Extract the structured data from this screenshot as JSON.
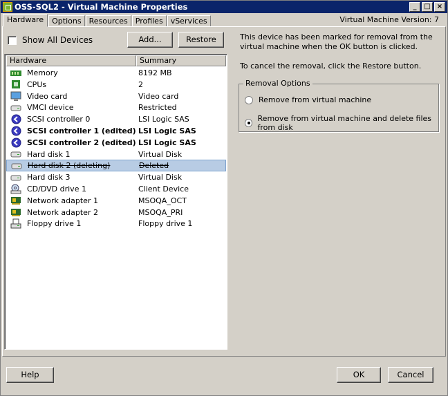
{
  "window": {
    "title": "OSS-SQL2 - Virtual Machine Properties",
    "version": "Virtual Machine Version: 7"
  },
  "tabs": [
    "Hardware",
    "Options",
    "Resources",
    "Profiles",
    "vServices"
  ],
  "show_all_devices": {
    "label": "Show All Devices",
    "checked": false
  },
  "buttons": {
    "add": "Add...",
    "restore": "Restore",
    "help": "Help",
    "ok": "OK",
    "cancel": "Cancel"
  },
  "table": {
    "headers": [
      "Hardware",
      "Summary"
    ],
    "rows": [
      {
        "name": "Memory",
        "summary": "8192 MB",
        "icon": "memory-icon"
      },
      {
        "name": "CPUs",
        "summary": "2",
        "icon": "cpu-icon"
      },
      {
        "name": "Video card",
        "summary": "Video card",
        "icon": "monitor-icon"
      },
      {
        "name": "VMCI device",
        "summary": "Restricted",
        "icon": "device-icon"
      },
      {
        "name": "SCSI controller 0",
        "summary": "LSI Logic SAS",
        "icon": "scsi-icon"
      },
      {
        "name": "SCSI controller 1 (edited)",
        "summary": "LSI Logic SAS",
        "icon": "scsi-icon",
        "edited": true
      },
      {
        "name": "SCSI controller 2 (edited)",
        "summary": "LSI Logic SAS",
        "icon": "scsi-icon",
        "edited": true
      },
      {
        "name": "Hard disk 1",
        "summary": "Virtual Disk",
        "icon": "hard-disk-icon"
      },
      {
        "name": "Hard disk 2 (deleting)",
        "summary": "Deleted",
        "icon": "hard-disk-icon",
        "deleting": true,
        "selected": true
      },
      {
        "name": "Hard disk 3",
        "summary": "Virtual Disk",
        "icon": "hard-disk-icon"
      },
      {
        "name": "CD/DVD drive 1",
        "summary": "Client Device",
        "icon": "cd-dvd-icon"
      },
      {
        "name": "Network adapter 1",
        "summary": "MSOQA_OCT",
        "icon": "network-adapter-icon"
      },
      {
        "name": "Network adapter 2",
        "summary": "MSOQA_PRI",
        "icon": "network-adapter-icon"
      },
      {
        "name": "Floppy drive 1",
        "summary": "Floppy drive 1",
        "icon": "floppy-icon"
      }
    ]
  },
  "details": {
    "line1": "This device has been marked for removal from the virtual machine when the OK button is clicked.",
    "line2": "To cancel the removal, click the Restore button.",
    "group_title": "Removal Options",
    "options": [
      {
        "label": "Remove from virtual machine",
        "selected": false
      },
      {
        "label": "Remove from virtual machine and delete files from disk",
        "selected": true
      }
    ]
  }
}
